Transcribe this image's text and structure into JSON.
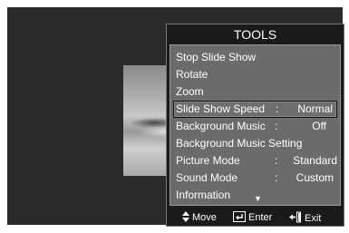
{
  "tools": {
    "title": "TOOLS",
    "items": [
      {
        "label": "Stop Slide Show",
        "sep": "",
        "value": ""
      },
      {
        "label": "Rotate",
        "sep": "",
        "value": ""
      },
      {
        "label": "Zoom",
        "sep": "",
        "value": ""
      },
      {
        "label": "Slide Show Speed",
        "sep": ":",
        "value": "Normal"
      },
      {
        "label": "Background Music",
        "sep": ":",
        "value": "Off"
      },
      {
        "label": "Background Music Setting",
        "sep": "",
        "value": ""
      },
      {
        "label": "Picture Mode",
        "sep": ":",
        "value": "Standard"
      },
      {
        "label": "Sound Mode",
        "sep": ":",
        "value": "Custom"
      },
      {
        "label": "Information",
        "sep": "",
        "value": ""
      }
    ],
    "selected_index": 3,
    "more_indicator": "▼"
  },
  "footer": {
    "move_icon": "up-down-arrows-icon",
    "move_label": "Move",
    "enter_icon": "enter-icon",
    "enter_label": "Enter",
    "exit_icon": "exit-door-icon",
    "exit_label": "Exit"
  }
}
